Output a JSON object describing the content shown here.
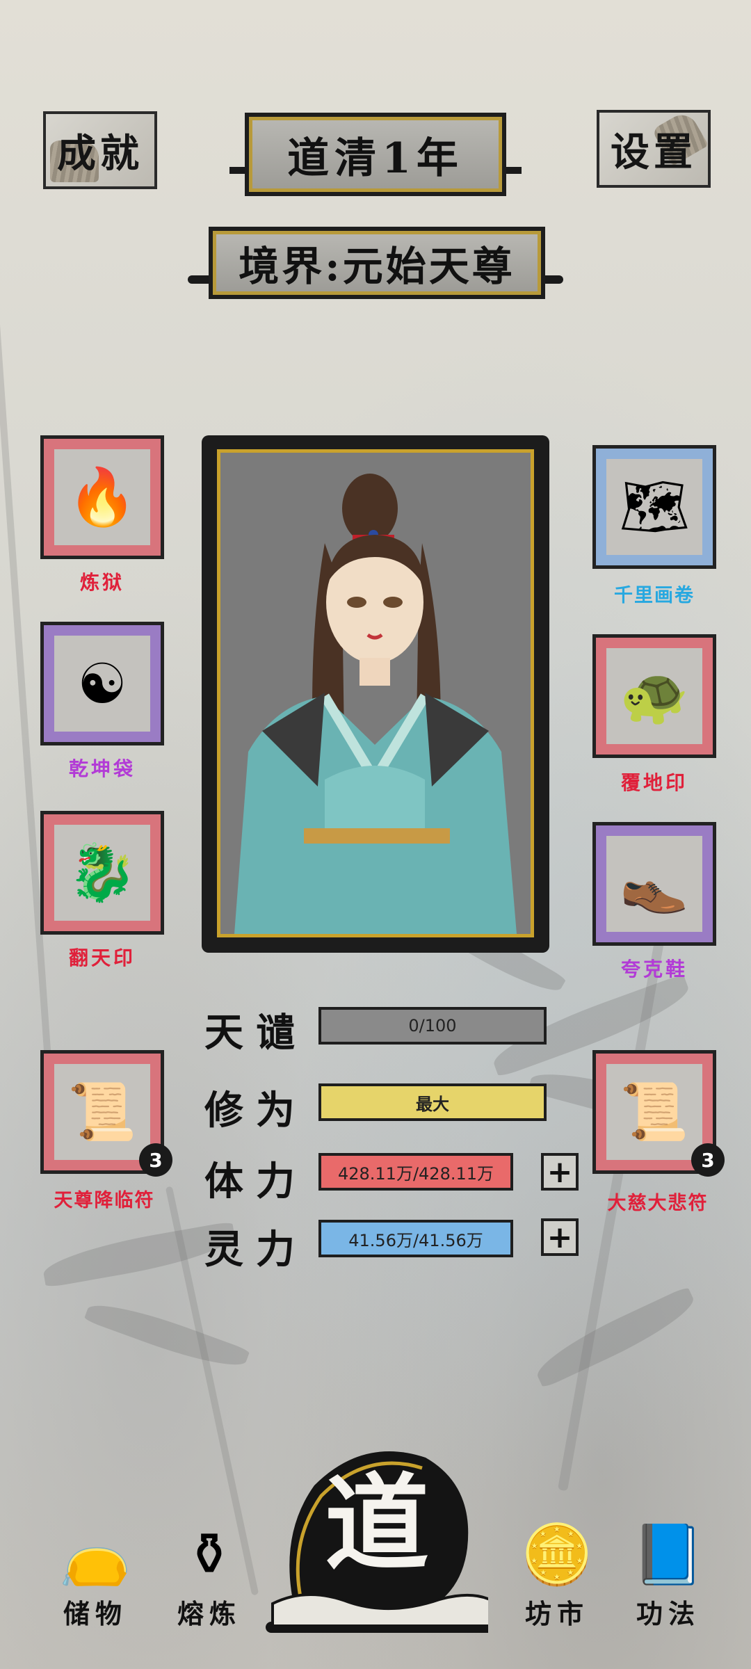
{
  "header": {
    "achievement_label": "成就",
    "year_title": "道清1年",
    "settings_label": "设置",
    "realm": "境界:元始天尊"
  },
  "left_items": [
    {
      "label": "炼狱",
      "icon": "fire-icon",
      "label_color": "#e0203a"
    },
    {
      "label": "乾坤袋",
      "icon": "yin-yang-bag-icon",
      "label_color": "#b23bd6"
    },
    {
      "label": "翻天印",
      "icon": "dragon-seal-icon",
      "label_color": "#e0203a"
    },
    {
      "label": "天尊降临符",
      "icon": "talisman-icon",
      "label_color": "#e0203a",
      "count": "3"
    }
  ],
  "right_items": [
    {
      "label": "千里画卷",
      "icon": "scroll-painting-icon",
      "label_color": "#27a8e0"
    },
    {
      "label": "覆地印",
      "icon": "turtle-seal-icon",
      "label_color": "#e0203a"
    },
    {
      "label": "夸克鞋",
      "icon": "shoe-icon",
      "label_color": "#b23bd6"
    },
    {
      "label": "大慈大悲符",
      "icon": "talisman-icon",
      "label_color": "#e0203a",
      "count": "3"
    }
  ],
  "stats": {
    "tribulation": {
      "label": "天谴",
      "value": "0/100",
      "fill": 0,
      "color": "#8a8a8a"
    },
    "cultivation": {
      "label": "修为",
      "value": "最大",
      "fill": 1,
      "color": "#e6d46a"
    },
    "stamina": {
      "label": "体力",
      "value": "428.11万/428.11万",
      "fill": 1,
      "color": "#e96a6a"
    },
    "spirit": {
      "label": "灵力",
      "value": "41.56万/41.56万",
      "fill": 1,
      "color": "#7ab6e6"
    }
  },
  "nav": {
    "storage": "储物",
    "smelting": "熔炼",
    "dao": "道",
    "market": "坊市",
    "skills": "功法"
  }
}
